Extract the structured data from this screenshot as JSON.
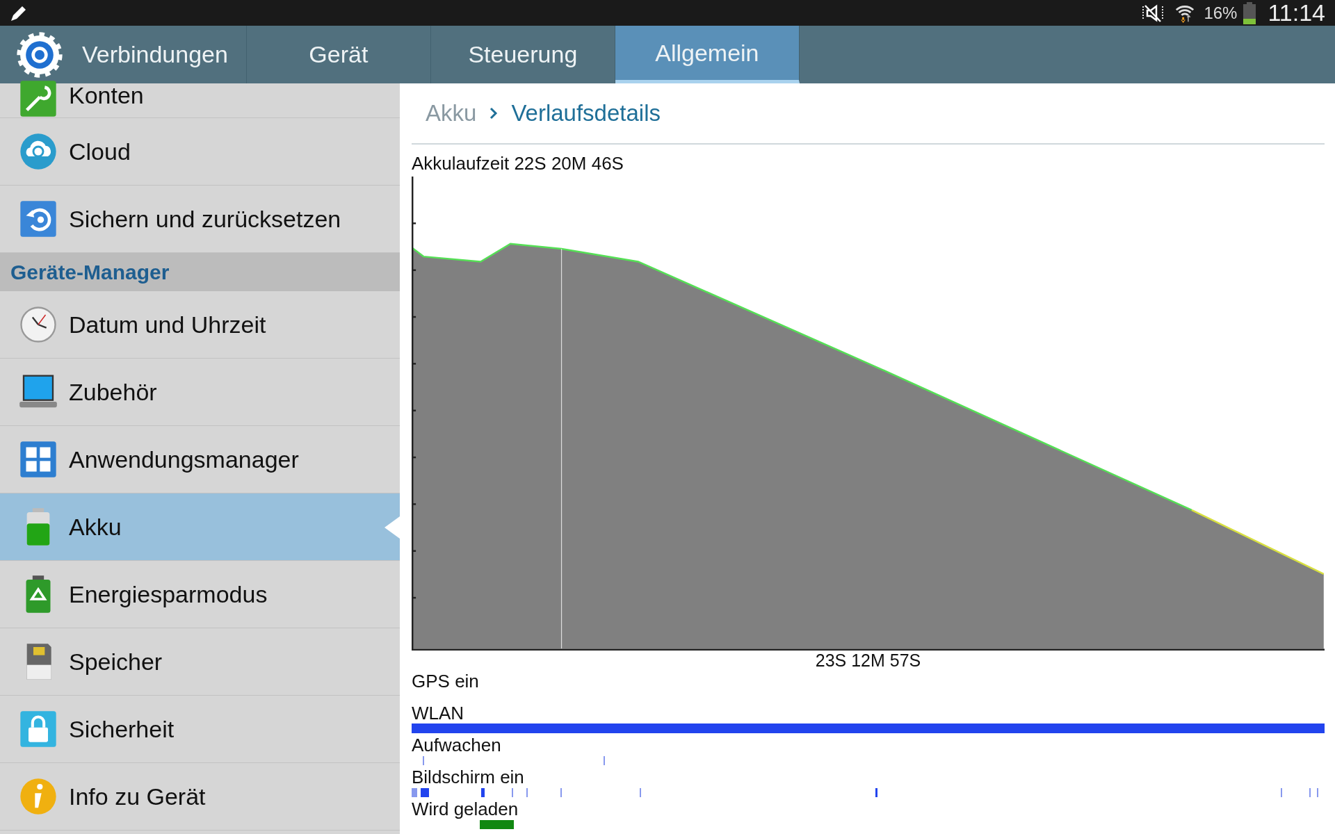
{
  "status_bar": {
    "battery_percent": "16%",
    "time": "11:14"
  },
  "tabs": [
    {
      "label": "Verbindungen",
      "selected": false
    },
    {
      "label": "Gerät",
      "selected": false
    },
    {
      "label": "Steuerung",
      "selected": false
    },
    {
      "label": "Allgemein",
      "selected": true
    }
  ],
  "sidebar": {
    "items": [
      {
        "kind": "item",
        "label": "Konten",
        "selected": false
      },
      {
        "kind": "item",
        "label": "Cloud",
        "selected": false
      },
      {
        "kind": "item",
        "label": "Sichern und zurücksetzen",
        "selected": false
      },
      {
        "kind": "header",
        "label": "Geräte-Manager"
      },
      {
        "kind": "item",
        "label": "Datum und Uhrzeit",
        "selected": false
      },
      {
        "kind": "item",
        "label": "Zubehör",
        "selected": false
      },
      {
        "kind": "item",
        "label": "Anwendungsmanager",
        "selected": false
      },
      {
        "kind": "item",
        "label": "Akku",
        "selected": true
      },
      {
        "kind": "item",
        "label": "Energiesparmodus",
        "selected": false
      },
      {
        "kind": "item",
        "label": "Speicher",
        "selected": false
      },
      {
        "kind": "item",
        "label": "Sicherheit",
        "selected": false
      },
      {
        "kind": "item",
        "label": "Info zu Gerät",
        "selected": false
      }
    ]
  },
  "breadcrumb": {
    "parent": "Akku",
    "current": "Verlaufsdetails"
  },
  "battery_chart": {
    "title": "Akkulaufzeit 22S 20M 46S",
    "x_label": "23S 12M 57S"
  },
  "events": [
    {
      "label": "GPS ein"
    },
    {
      "label": "WLAN"
    },
    {
      "label": "Aufwachen"
    },
    {
      "label": "Bildschirm ein"
    },
    {
      "label": "Wird geladen"
    }
  ]
}
